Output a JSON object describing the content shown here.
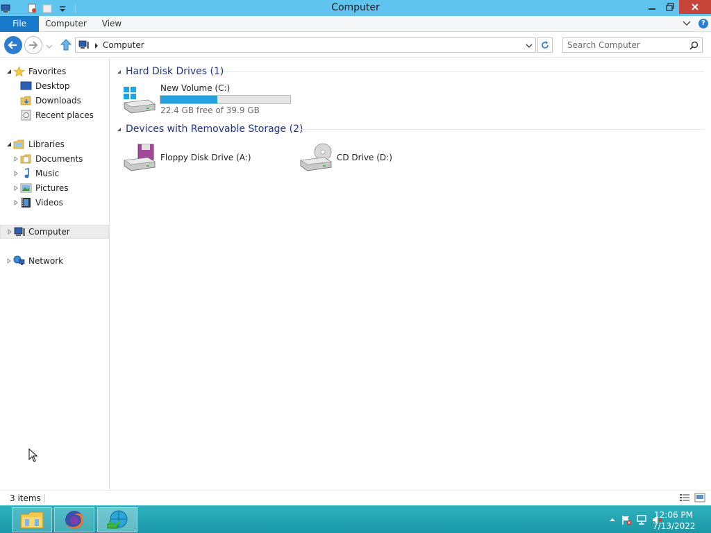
{
  "window": {
    "title": "Computer"
  },
  "ribbon": {
    "tabs": [
      {
        "label": "File"
      },
      {
        "label": "Computer"
      },
      {
        "label": "View"
      }
    ],
    "help_label": "?"
  },
  "address": {
    "crumb": "Computer"
  },
  "search": {
    "placeholder": "Search Computer"
  },
  "nav": {
    "favorites": {
      "label": "Favorites",
      "items": [
        {
          "label": "Desktop"
        },
        {
          "label": "Downloads"
        },
        {
          "label": "Recent places"
        }
      ]
    },
    "libraries": {
      "label": "Libraries",
      "items": [
        {
          "label": "Documents"
        },
        {
          "label": "Music"
        },
        {
          "label": "Pictures"
        },
        {
          "label": "Videos"
        }
      ]
    },
    "computer": {
      "label": "Computer"
    },
    "network": {
      "label": "Network"
    }
  },
  "content": {
    "groups": [
      {
        "header": "Hard Disk Drives (1)",
        "drives": [
          {
            "name": "New Volume (C:)",
            "free": "22.4 GB free of 39.9 GB",
            "used_fraction": 0.44
          }
        ]
      },
      {
        "header": "Devices with Removable Storage (2)",
        "drives": [
          {
            "name": "Floppy Disk Drive (A:)"
          },
          {
            "name": "CD Drive (D:)"
          }
        ]
      }
    ]
  },
  "status": {
    "item_count": "3 items"
  },
  "taskbar": {
    "apps": [
      "file-explorer",
      "firefox",
      "download-manager"
    ],
    "clock_time": "12:06 PM",
    "clock_date": "7/13/2022"
  },
  "colors": {
    "titlebar": "#5fc4ee",
    "file_tab": "#1979ca",
    "close": "#c7443a",
    "group_header": "#1e3287",
    "progress": "#26a0da",
    "taskbar": "#1fa0ae"
  }
}
